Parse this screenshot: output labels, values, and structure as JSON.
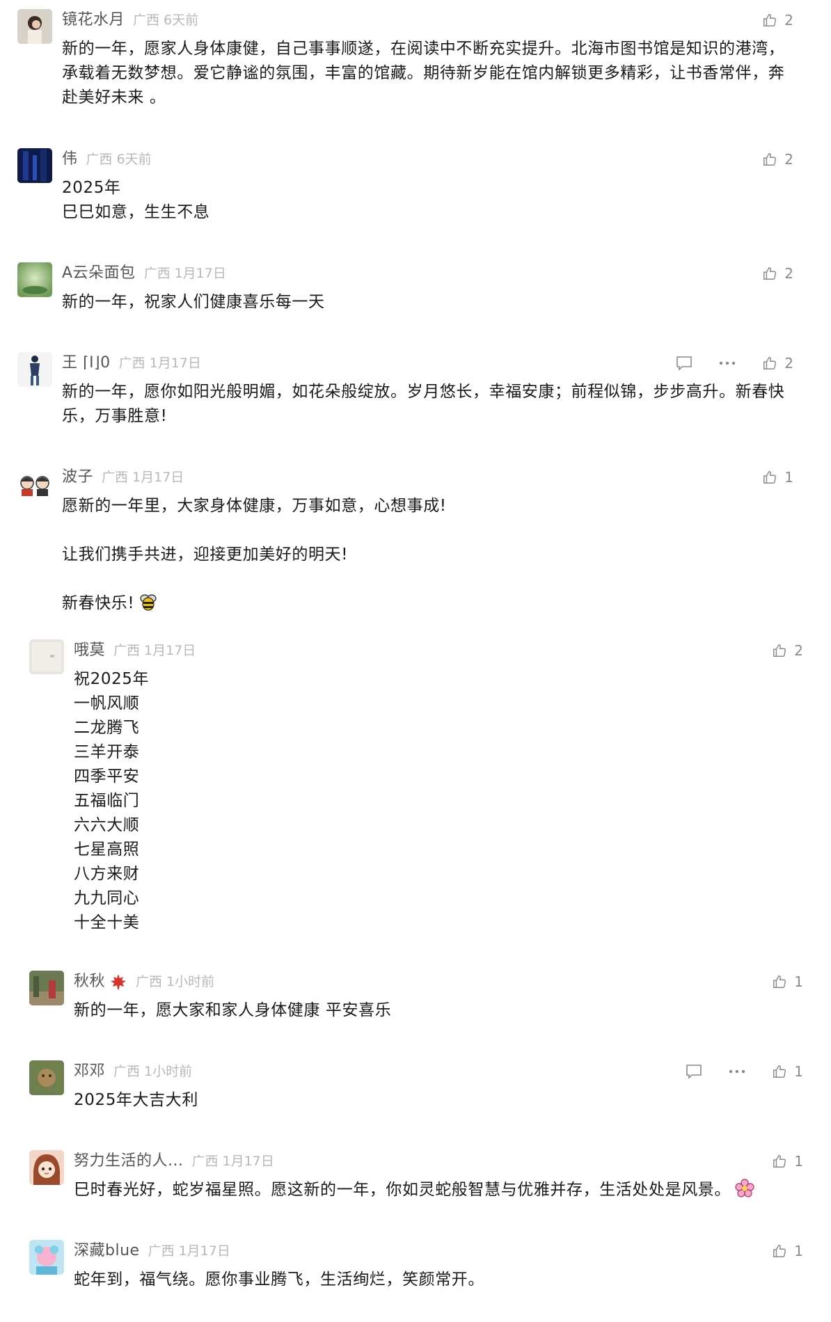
{
  "comments": [
    {
      "nick": "镜花水月",
      "location": "广西",
      "time": "6天前",
      "likes": "2",
      "lines": [
        "新的一年，愿家人身体康健，自己事事顺遂，在阅读中不断充实提升。北海市图书馆是知识的港湾，承载着无数梦想。爱它静谧的氛围，丰富的馆藏。期待新岁能在馆内解锁更多精彩，让书香常伴，奔赴美好未来 。"
      ]
    },
    {
      "nick": "伟",
      "location": "广西",
      "time": "6天前",
      "likes": "2",
      "lines": [
        "2025年",
        "巳巳如意，生生不息"
      ]
    },
    {
      "nick": "A云朵面包",
      "location": "广西",
      "time": "1月17日",
      "likes": "2",
      "lines": [
        "新的一年，祝家人们健康喜乐每一天"
      ]
    },
    {
      "nick": "王 ⌈I⌋0",
      "location": "广西",
      "time": "1月17日",
      "likes": "2",
      "lines": [
        "新的一年，愿你如阳光般明媚，如花朵般绽放。岁月悠长，幸福安康；前程似锦，步步高升。新春快乐，万事胜意!"
      ]
    },
    {
      "nick": "波子",
      "location": "广西",
      "time": "1月17日",
      "likes": "1",
      "lines": [
        "愿新的一年里，大家身体健康，万事如意，心想事成!",
        "",
        "让我们携手共进，迎接更加美好的明天!",
        "",
        "新春快乐!"
      ]
    },
    {
      "nick": "哦莫",
      "location": "广西",
      "time": "1月17日",
      "likes": "2",
      "lines": [
        "祝2025年",
        "一帆风顺",
        "二龙腾飞",
        "三羊开泰",
        "四季平安",
        "五福临门",
        "六六大顺",
        "七星高照",
        "八方来财",
        "九九同心",
        "十全十美"
      ]
    },
    {
      "nick": "秋秋",
      "location": "广西",
      "time": "1小时前",
      "likes": "1",
      "lines": [
        "新的一年，愿大家和家人身体健康 平安喜乐"
      ]
    },
    {
      "nick": "邓邓",
      "location": "广西",
      "time": "1小时前",
      "likes": "1",
      "lines": [
        "2025年大吉大利"
      ]
    },
    {
      "nick": "努力生活的人...",
      "location": "广西",
      "time": "1月17日",
      "likes": "1",
      "lines": [
        "巳时春光好，蛇岁福星照。愿这新的一年，你如灵蛇般智慧与优雅并存，生活处处是风景。"
      ]
    },
    {
      "nick": "深藏blue",
      "location": "广西",
      "time": "1月17日",
      "likes": "1",
      "lines": [
        "蛇年到，福气绕。愿你事业腾飞，生活绚烂，笑颜常开。"
      ]
    }
  ],
  "icons": {
    "like": "thumbs-up-icon",
    "reply": "comment-bubble-icon",
    "more": "more-dots-icon",
    "badge_maple": "maple-leaf-icon",
    "emoji_bee": "bee-emoji-icon",
    "emoji_flower": "flower-emoji-icon"
  },
  "colors": {
    "nickname": "#555555",
    "meta": "#b8b8b8",
    "content": "#1a1a1a",
    "action": "#8a8a8a"
  }
}
